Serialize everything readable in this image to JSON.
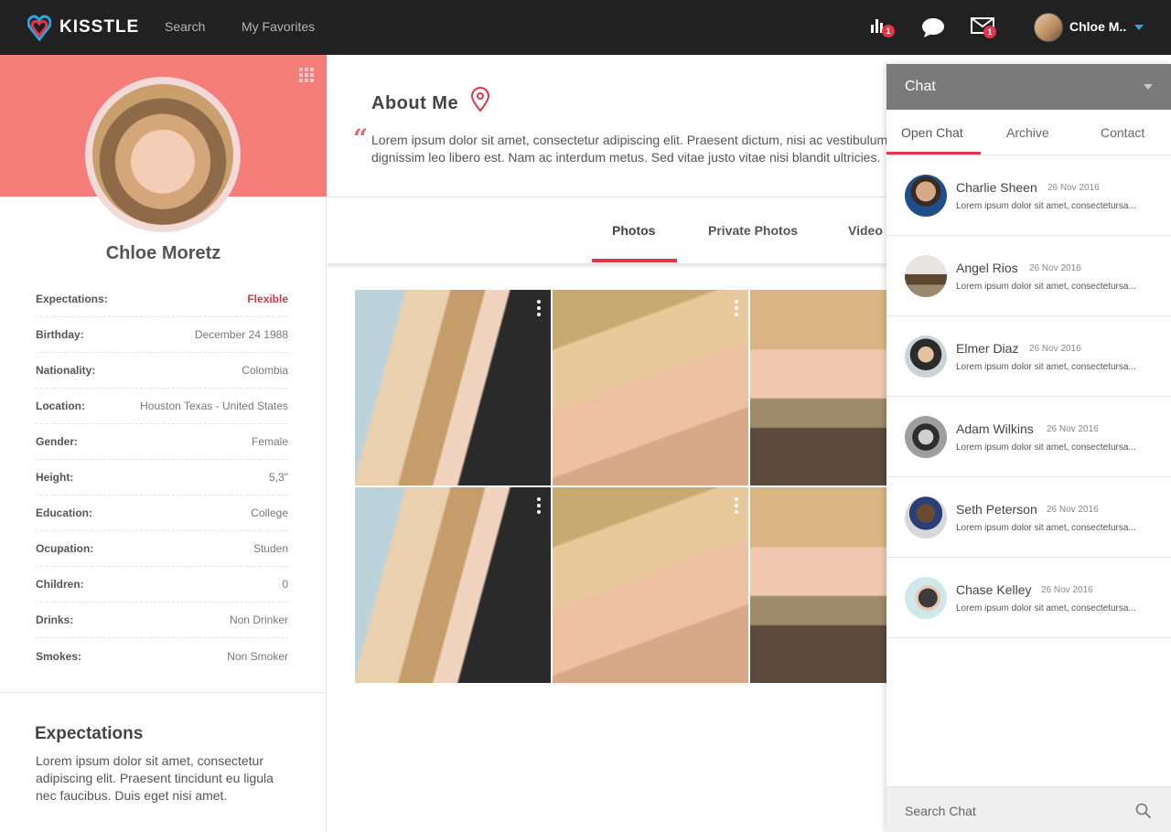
{
  "app": {
    "logo_text": "KISSTLE",
    "nav": [
      "Search",
      "My Favorites"
    ],
    "notifications": {
      "stats_badge": "1",
      "mail_badge": "1"
    },
    "user_name": "Chloe M..",
    "colors": {
      "accent": "#e0354a",
      "banner": "#f47d7a",
      "topbar": "#212121",
      "caret": "#2aa7e0"
    }
  },
  "profile": {
    "name": "Chloe Moretz",
    "fields": [
      {
        "label": "Expectations:",
        "value": "Flexible"
      },
      {
        "label": "Birthday:",
        "value": "December 24 1988"
      },
      {
        "label": "Nationality:",
        "value": "Colombia"
      },
      {
        "label": "Location:",
        "value": "Houston Texas - United States"
      },
      {
        "label": "Gender:",
        "value": "Female"
      },
      {
        "label": "Height:",
        "value": "5,3\""
      },
      {
        "label": "Education:",
        "value": "College"
      },
      {
        "label": "Ocupation:",
        "value": "Studen"
      },
      {
        "label": "Children:",
        "value": "0"
      },
      {
        "label": "Drinks:",
        "value": "Non Drinker"
      },
      {
        "label": "Smokes:",
        "value": "Non Smoker"
      }
    ],
    "expectations_title": "Expectations",
    "expectations_text": "Lorem ipsum dolor sit amet, consectetur adipiscing elit. Praesent tincidunt eu ligula nec faucibus. Duis eget nisi amet."
  },
  "about": {
    "title": "About Me",
    "quote_mark": "“",
    "line1": "Lorem ipsum dolor sit amet, consectetur adipiscing elit. Praesent dictum, nisi ac vestibulum",
    "line2": "dignissim leo libero est. Nam ac interdum metus. Sed vitae justo vitae nisi blandit ultricies."
  },
  "tabs": [
    "Photos",
    "Private Photos",
    "Video"
  ],
  "active_tab": "Photos",
  "chat": {
    "title": "Chat",
    "tabs": [
      "Open Chat",
      "Archive",
      "Contact"
    ],
    "active_tab": "Open Chat",
    "conversations": [
      {
        "name": "Charlie Sheen",
        "date": "26 Nov 2016",
        "preview": "Lorem ipsum dolor sit amet, consectetursa..."
      },
      {
        "name": "Angel Rios",
        "date": "26 Nov 2016",
        "preview": "Lorem ipsum dolor sit amet, consectetursa..."
      },
      {
        "name": "Elmer Diaz",
        "date": "26 Nov 2016",
        "preview": "Lorem ipsum dolor sit amet, consectetursa..."
      },
      {
        "name": "Adam Wilkins",
        "date": "26 Nov 2016",
        "preview": "Lorem ipsum dolor sit amet, consectetursa..."
      },
      {
        "name": "Seth Peterson",
        "date": "26 Nov 2016",
        "preview": "Lorem ipsum dolor sit amet, consectetursa..."
      },
      {
        "name": "Chase Kelley",
        "date": "26 Nov 2016",
        "preview": "Lorem ipsum dolor sit amet, consectetursa..."
      }
    ],
    "search_placeholder": "Search Chat"
  }
}
